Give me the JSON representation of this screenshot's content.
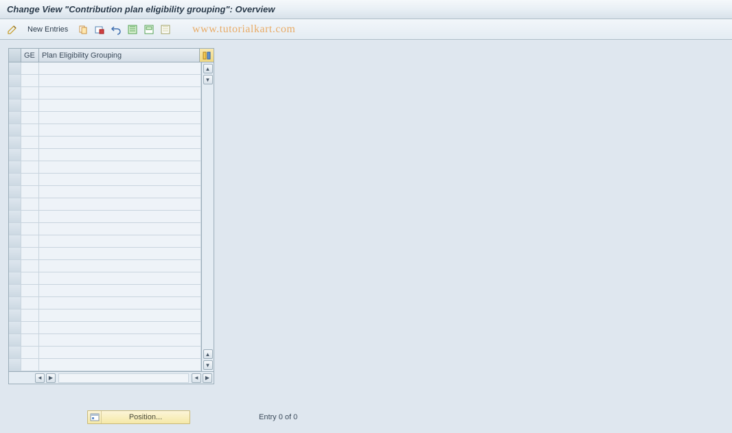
{
  "title": "Change View \"Contribution plan eligibility grouping\": Overview",
  "toolbar": {
    "new_entries_label": "New Entries"
  },
  "watermark": "www.tutorialkart.com",
  "grid": {
    "columns": {
      "ge": "GE",
      "desc": "Plan Eligibility Grouping"
    },
    "row_count": 25
  },
  "footer": {
    "position_label": "Position...",
    "entry_status": "Entry 0 of 0"
  }
}
